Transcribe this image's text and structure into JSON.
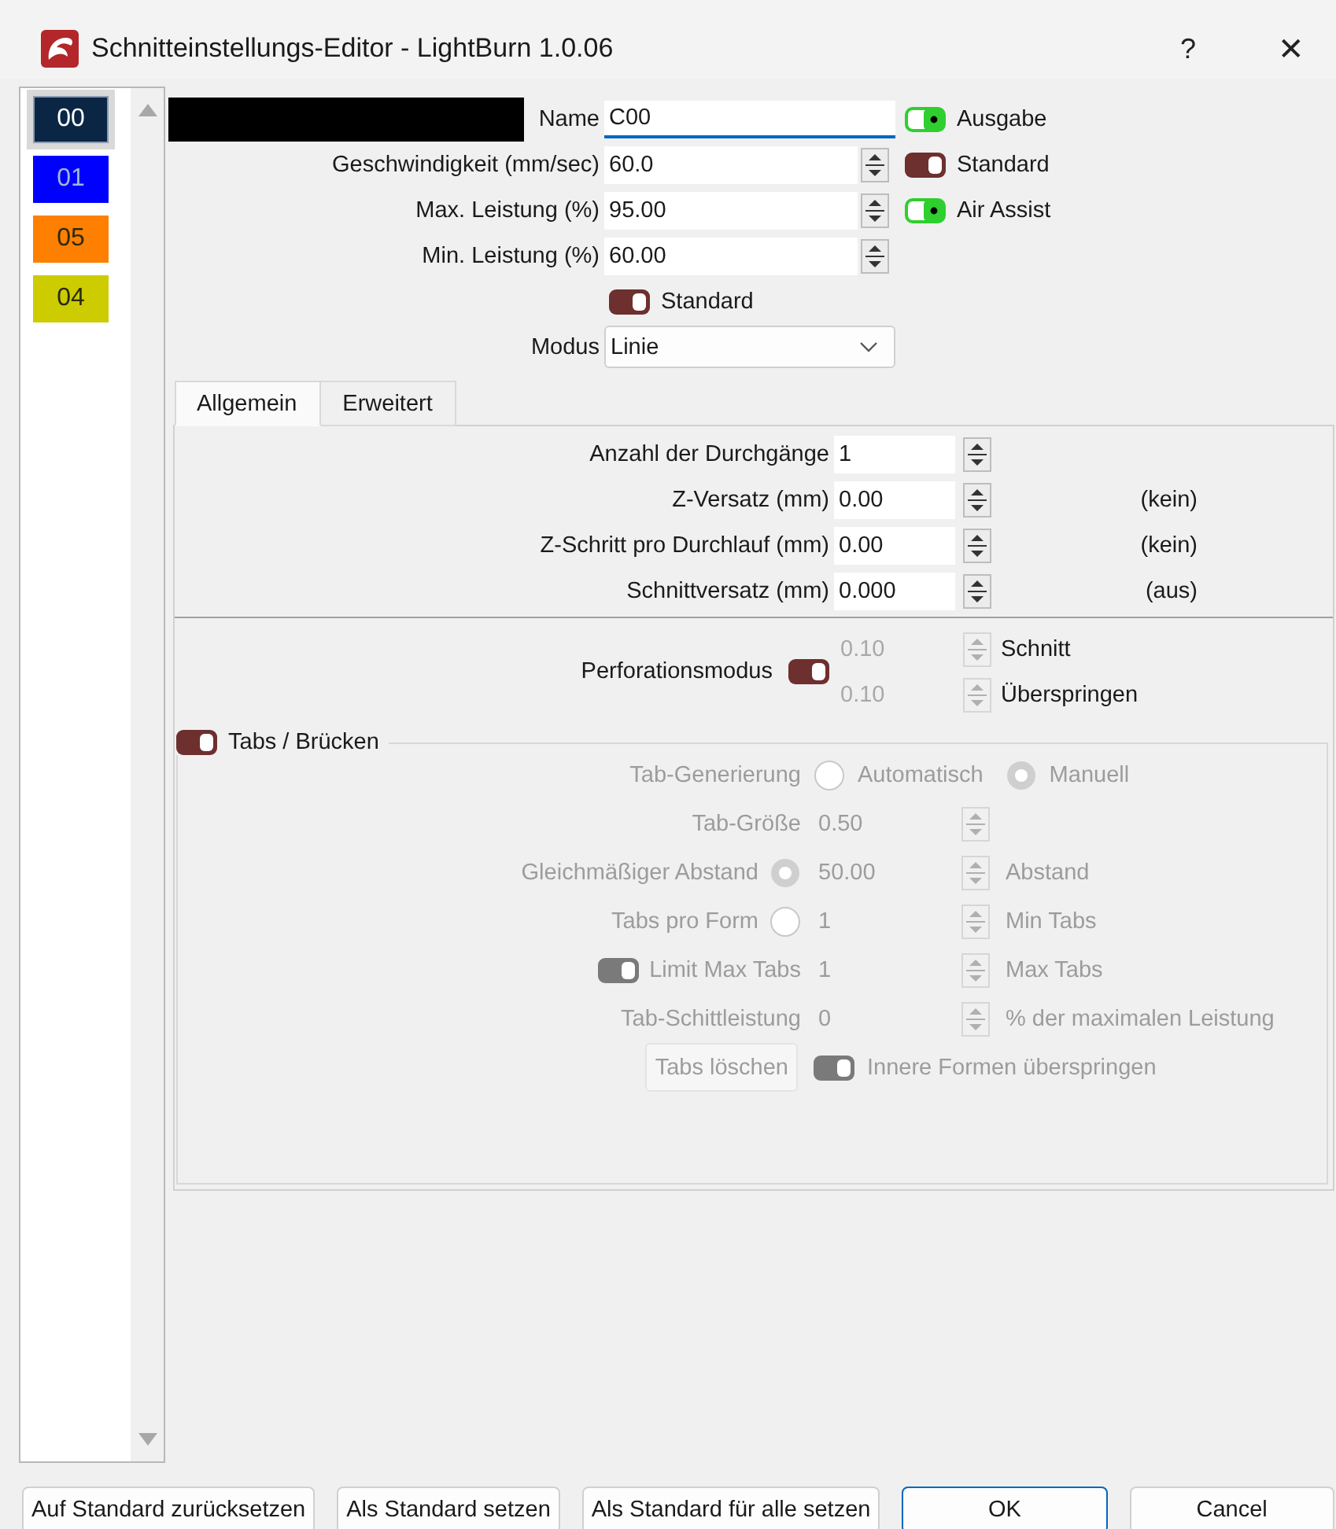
{
  "window": {
    "title": "Schnitteinstellungs-Editor - LightBurn 1.0.06",
    "help": "?",
    "close": "✕"
  },
  "layers": [
    {
      "label": "00",
      "color": "#0b2645",
      "selected": true
    },
    {
      "label": "01",
      "color": "#0000ff",
      "selected": false
    },
    {
      "label": "05",
      "color": "#ff7f00",
      "selected": false
    },
    {
      "label": "04",
      "color": "#cccc00",
      "selected": false
    }
  ],
  "name": {
    "label": "Name",
    "value": "C00",
    "focused": true
  },
  "fields": [
    {
      "label": "Geschwindigkeit (mm/sec)",
      "value": "60.0"
    },
    {
      "label": "Max. Leistung (%)",
      "value": "95.00"
    },
    {
      "label": "Min. Leistung (%)",
      "value": "60.00"
    }
  ],
  "switches": [
    {
      "label": "Ausgabe",
      "on": true
    },
    {
      "label": "Standard",
      "on": false
    },
    {
      "label": "Air Assist",
      "on": true
    }
  ],
  "power_default": {
    "label": "Standard",
    "on": false
  },
  "mode": {
    "label": "Modus",
    "value": "Linie"
  },
  "tabs": [
    {
      "label": "Allgemein",
      "selected": true
    },
    {
      "label": "Erweitert",
      "selected": false
    }
  ],
  "general": [
    {
      "label": "Anzahl der Durchgänge",
      "value": "1"
    },
    {
      "label": "Z-Versatz (mm)",
      "value": "0.00",
      "note": "(kein)"
    },
    {
      "label": "Z-Schritt pro Durchlauf (mm)",
      "value": "0.00",
      "note": "(kein)"
    },
    {
      "label": "Schnittversatz (mm)",
      "value": "0.000",
      "note": "(aus)"
    }
  ],
  "perforation": {
    "label": "Perforationsmodus",
    "on": false,
    "rows": [
      {
        "value": "0.10",
        "label": "Schnitt"
      },
      {
        "value": "0.10",
        "label": "Überspringen"
      }
    ]
  },
  "tabs_group": {
    "label": "Tabs / Brücken",
    "on": false,
    "disabled": true,
    "generation": {
      "label": "Tab-Generierung",
      "options": [
        {
          "label": "Automatisch",
          "selected": false
        },
        {
          "label": "Manuell",
          "selected": true
        }
      ]
    },
    "rows": [
      {
        "kind": "plain",
        "label": "Tab-Größe",
        "value": "0.50"
      },
      {
        "kind": "radio",
        "label": "Gleichmäßiger Abstand",
        "selected": true,
        "value": "50.00",
        "suffix": "Abstand"
      },
      {
        "kind": "radio",
        "label": "Tabs pro Form",
        "selected": false,
        "value": "1",
        "suffix": "Min Tabs"
      },
      {
        "kind": "switch",
        "label": "Limit Max Tabs",
        "on": false,
        "value": "1",
        "suffix": "Max Tabs"
      },
      {
        "kind": "plain",
        "label": "Tab-Schittleistung",
        "value": "0",
        "suffix": "% der maximalen Leistung"
      }
    ],
    "clear_button": "Tabs löschen",
    "skip_inner": {
      "label": "Innere Formen überspringen",
      "on": false
    }
  },
  "buttons": [
    {
      "label": "Auf Standard zurücksetzen",
      "default": false
    },
    {
      "label": "Als Standard setzen",
      "default": false
    },
    {
      "label": "Als Standard für alle setzen",
      "default": false
    },
    {
      "label": "OK",
      "default": true
    },
    {
      "label": "Cancel",
      "default": false
    }
  ]
}
